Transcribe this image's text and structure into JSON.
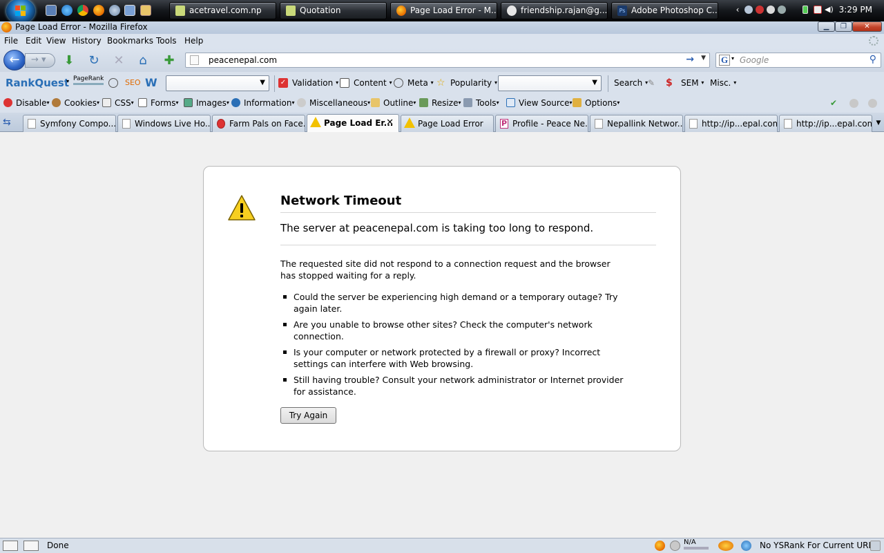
{
  "taskbar": {
    "tasks": [
      {
        "label": "acetravel.com.np"
      },
      {
        "label": "Quotation"
      },
      {
        "label": "Page Load Error - M..."
      },
      {
        "label": "friendship.rajan@g..."
      },
      {
        "label": "Adobe Photoshop C..."
      }
    ],
    "clock": "3:29 PM",
    "ps_badge": "Ps"
  },
  "window": {
    "title": "Page Load Error - Mozilla Firefox"
  },
  "menu": {
    "items": [
      "File",
      "Edit",
      "View",
      "History",
      "Bookmarks",
      "Tools",
      "Help"
    ]
  },
  "navbar": {
    "url": "peacenepal.com",
    "search_placeholder": "Google"
  },
  "rankquest": {
    "logo": "RankQuest",
    "pagerank": "PageRank",
    "seo": "SEO",
    "validation": "Validation",
    "content": "Content",
    "meta": "Meta",
    "popularity": "Popularity",
    "search": "Search",
    "sem": "SEM",
    "misc": "Misc."
  },
  "webdev": {
    "items": [
      "Disable",
      "Cookies",
      "CSS",
      "Forms",
      "Images",
      "Information",
      "Miscellaneous",
      "Outline",
      "Resize",
      "Tools",
      "View Source",
      "Options"
    ]
  },
  "tabs": [
    {
      "label": "Symfony Compo..."
    },
    {
      "label": "Windows Live Ho..."
    },
    {
      "label": "Farm Pals on Face..."
    },
    {
      "label": "Page Load Er..."
    },
    {
      "label": "Page Load Error"
    },
    {
      "label": "Profile - Peace Ne..."
    },
    {
      "label": "Nepallink Networ..."
    },
    {
      "label": "http://ip...epal.com"
    },
    {
      "label": "http://ip...epal.com"
    }
  ],
  "error": {
    "title": "Network Timeout",
    "short": "The server at peacenepal.com is taking too long to respond.",
    "long": "The requested site did not respond to a connection request and the browser has stopped waiting for a reply.",
    "suggestions": [
      "Could the server be experiencing high demand or a temporary outage? Try again later.",
      "Are you unable to browse other sites? Check the computer's network connection.",
      "Is your computer or network protected by a firewall or proxy? Incorrect settings can interfere with Web browsing.",
      "Still having trouble? Consult your network administrator or Internet provider for assistance."
    ],
    "button": "Try Again"
  },
  "status": {
    "text": "Done",
    "na": "N/A",
    "ysrank": "No YSRank For Current URL"
  },
  "colors": {
    "link_blue": "#2a6fb6",
    "warning_yellow": "#f2c100",
    "close_red": "#c2432a"
  }
}
